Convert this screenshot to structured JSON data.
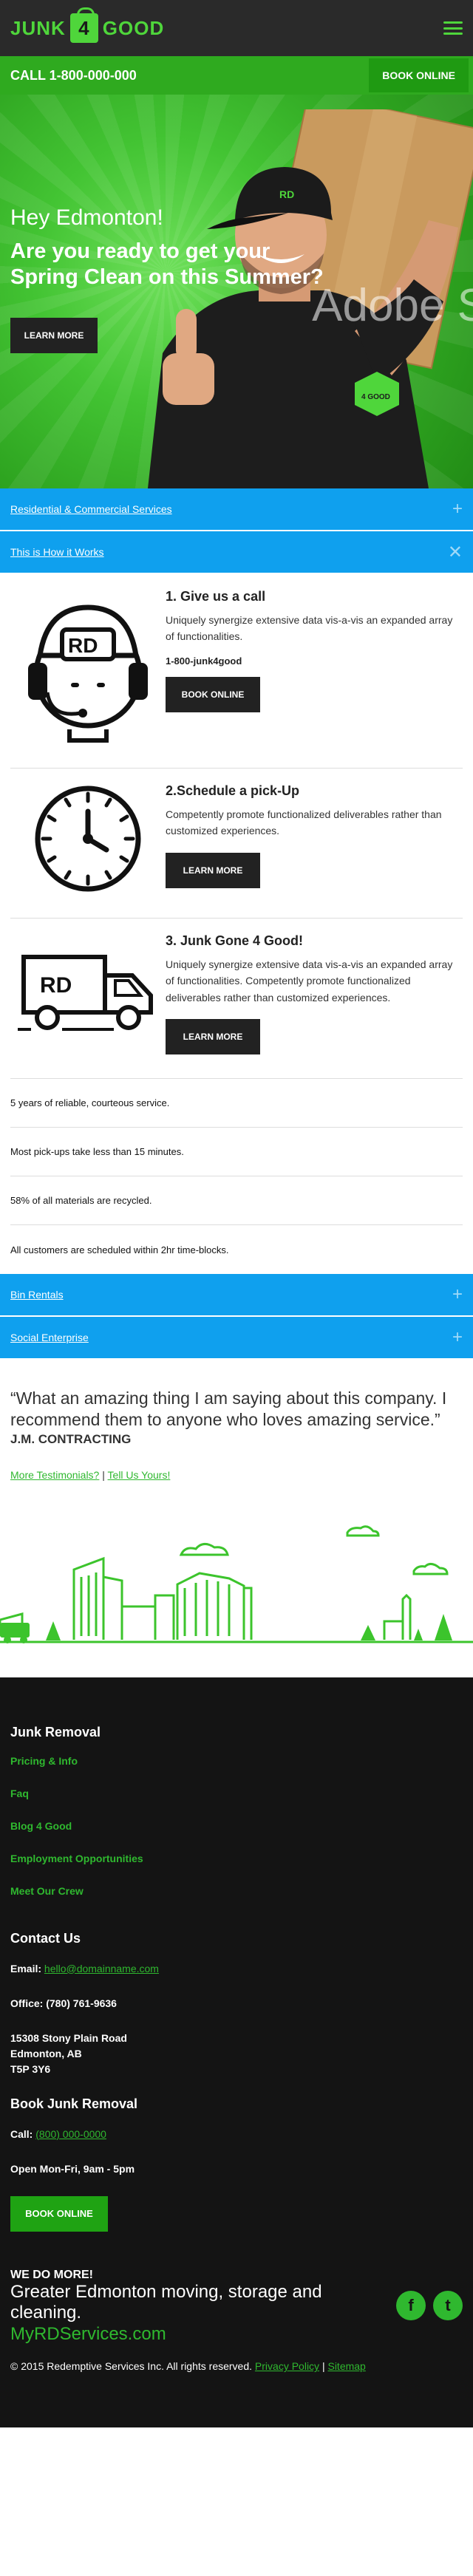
{
  "header": {
    "logo_left": "JUNK",
    "logo_mid": "4",
    "logo_right": "GOOD"
  },
  "callbar": {
    "phone": "CALL 1-800-000-000",
    "book": "BOOK ONLINE"
  },
  "hero": {
    "greeting": "Hey Edmonton!",
    "headline": "Are you ready to get your Spring Clean on this Summer?",
    "learn": "LEARN MORE",
    "watermark": "Adobe S",
    "cap_badge": "RD",
    "shirt_badge": "4 GOOD"
  },
  "accordions": {
    "a1": "Residential & Commercial Services",
    "a2": "This is How it Works",
    "a3": "Bin Rentals",
    "a4": "Social Enterprise"
  },
  "steps": [
    {
      "title": "1. Give us a call",
      "text": "Uniquely synergize extensive data vis-a-vis an expanded array of functionalities.",
      "tel": "1-800-junk4good",
      "btn": "BOOK ONLINE",
      "badge": "RD"
    },
    {
      "title": "2.Schedule a pick-Up",
      "text": "Competently promote functionalized deliverables rather than customized experiences.",
      "btn": "LEARN MORE"
    },
    {
      "title": "3. Junk Gone 4 Good!",
      "text": "Uniquely synergize extensive data vis-a-vis an expanded array of functionalities. Competently promote functionalized deliverables rather than customized experiences.",
      "btn": "LEARN MORE",
      "badge": "RD"
    }
  ],
  "facts": [
    "5 years of reliable, courteous service.",
    "Most pick-ups take less than 15 minutes.",
    "58% of all materials are recycled.",
    "All customers are scheduled within 2hr time-blocks."
  ],
  "testimonial": {
    "quote": "“What an amazing thing I am saying about this company. I recommend them to anyone who loves amazing service.”",
    "author": "J.M. CONTRACTING",
    "more": "More Testimonials?",
    "sep": "|",
    "tell": "Tell Us Yours!"
  },
  "footer": {
    "removal_title": "Junk Removal",
    "links": [
      "Pricing & Info",
      "Faq",
      "Blog 4 Good",
      "Employment Opportunities",
      "Meet Our Crew"
    ],
    "contact_title": "Contact Us",
    "email_label": "Email:",
    "email": "hello@domainname.com",
    "office": "Office: (780) 761-9636",
    "address1": "15308 Stony Plain Road",
    "address2": "Edmonton, AB",
    "address3": "T5P 3Y6",
    "book_title": "Book Junk Removal",
    "call_label": "Call:",
    "call": "(800) 000-0000",
    "hours": "Open Mon-Fri, 9am - 5pm",
    "book_btn": "BOOK ONLINE",
    "domore_title": "WE DO MORE!",
    "domore_text": "Greater Edmonton moving, storage and cleaning.",
    "domore_site": "MyRDServices.com",
    "facebook": "f",
    "twitter": "t",
    "copy": "© 2015 Redemptive Services Inc. All rights reserved.",
    "privacy": "Privacy Policy",
    "sep": "|",
    "sitemap": "Sitemap"
  },
  "colors": {
    "brand_green": "#4fd63b",
    "cta_green": "#1fa313",
    "accordion_blue": "#0fa0ee",
    "dark": "#222222"
  }
}
